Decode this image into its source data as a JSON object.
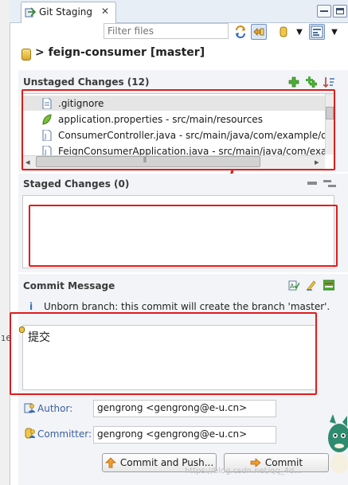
{
  "view": {
    "tab_title": "Git Staging",
    "close_glyph": "✕",
    "minimize": "minimize-icon",
    "maximize": "maximize-icon"
  },
  "toolbar": {
    "filter_placeholder": "Filter files"
  },
  "repo": {
    "title": "> feign-consumer [master]"
  },
  "unstaged": {
    "title": "Unstaged Changes (12)",
    "items": [
      {
        "label": ".gitignore",
        "icon": "text-file-icon"
      },
      {
        "label": "application.properties - src/main/resources",
        "icon": "properties-file-icon"
      },
      {
        "label": "ConsumerController.java - src/main/java/com/example/de",
        "icon": "java-file-icon"
      },
      {
        "label": "FeignConsumerApplication.java - src/main/java/com/exam",
        "icon": "java-file-icon"
      }
    ],
    "scroll_glyph_left": "◂",
    "scroll_glyph_right": "▸",
    "scroll_grip": "⦀"
  },
  "staged": {
    "title": "Staged Changes (0)"
  },
  "commit": {
    "title": "Commit Message",
    "hint": "Unborn branch: this commit will create the branch 'master'.",
    "message": "提交",
    "author_label": "Author:",
    "author_value": "gengrong <gengrong@e-u.cn>",
    "committer_label": "Committer:",
    "committer_value": "gengrong <gengrong@e-u.cn>",
    "commit_push_label": "Commit and Push...",
    "commit_label": "Commit"
  },
  "left_strip": {
    "text": "16"
  },
  "watermark": "https://blog.csdn.net/qq_4d..."
}
